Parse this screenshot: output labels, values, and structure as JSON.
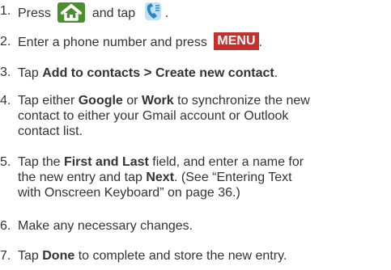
{
  "steps": [
    {
      "num": "1.",
      "pre": "Press",
      "icon1": "home-icon",
      "mid": "and tap",
      "icon2": "phone-icon",
      "post": "."
    },
    {
      "num": "2.",
      "pre": "Enter a phone number and press",
      "key": "MENU",
      "post": "."
    },
    {
      "num": "3.",
      "pre": "Tap",
      "b1": "Add to contacts",
      "sep": ">",
      "b2": "Create new contact",
      "post": "."
    },
    {
      "num": "4.",
      "pre": "Tap either",
      "b1": "Google",
      "mid": "or",
      "b2": "Work",
      "line1_post": "to synchronize the new",
      "line2": "contact to either your Gmail account or Outlook",
      "line3": "contact list."
    },
    {
      "num": "5.",
      "pre": "Tap the",
      "b1": "First and Last",
      "line1_post": "field, and enter a name for",
      "line2_pre": "the new entry and tap",
      "b2": "Next",
      "line2_post": ". (See “Entering Text",
      "line3": "with Onscreen Keyboard” on page 36.)"
    },
    {
      "num": "6.",
      "text": "Make any necessary changes."
    },
    {
      "num": "7.",
      "pre": "Tap",
      "b1": "Done",
      "post": "to complete and store the new entry."
    }
  ],
  "colors": {
    "text": "#333333",
    "home_key": "#4a8f2d",
    "menu_key": "#c4302b"
  }
}
